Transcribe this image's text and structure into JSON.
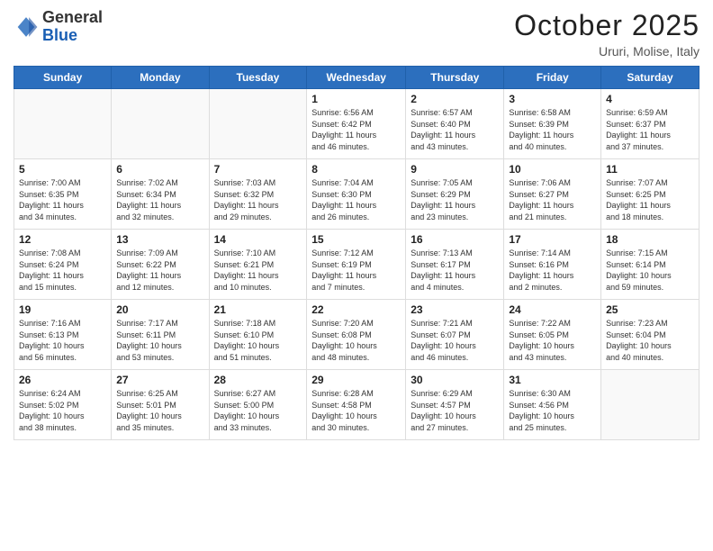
{
  "header": {
    "logo_general": "General",
    "logo_blue": "Blue",
    "month": "October 2025",
    "location": "Ururi, Molise, Italy"
  },
  "weekdays": [
    "Sunday",
    "Monday",
    "Tuesday",
    "Wednesday",
    "Thursday",
    "Friday",
    "Saturday"
  ],
  "weeks": [
    [
      {
        "day": "",
        "info": ""
      },
      {
        "day": "",
        "info": ""
      },
      {
        "day": "",
        "info": ""
      },
      {
        "day": "1",
        "info": "Sunrise: 6:56 AM\nSunset: 6:42 PM\nDaylight: 11 hours\nand 46 minutes."
      },
      {
        "day": "2",
        "info": "Sunrise: 6:57 AM\nSunset: 6:40 PM\nDaylight: 11 hours\nand 43 minutes."
      },
      {
        "day": "3",
        "info": "Sunrise: 6:58 AM\nSunset: 6:39 PM\nDaylight: 11 hours\nand 40 minutes."
      },
      {
        "day": "4",
        "info": "Sunrise: 6:59 AM\nSunset: 6:37 PM\nDaylight: 11 hours\nand 37 minutes."
      }
    ],
    [
      {
        "day": "5",
        "info": "Sunrise: 7:00 AM\nSunset: 6:35 PM\nDaylight: 11 hours\nand 34 minutes."
      },
      {
        "day": "6",
        "info": "Sunrise: 7:02 AM\nSunset: 6:34 PM\nDaylight: 11 hours\nand 32 minutes."
      },
      {
        "day": "7",
        "info": "Sunrise: 7:03 AM\nSunset: 6:32 PM\nDaylight: 11 hours\nand 29 minutes."
      },
      {
        "day": "8",
        "info": "Sunrise: 7:04 AM\nSunset: 6:30 PM\nDaylight: 11 hours\nand 26 minutes."
      },
      {
        "day": "9",
        "info": "Sunrise: 7:05 AM\nSunset: 6:29 PM\nDaylight: 11 hours\nand 23 minutes."
      },
      {
        "day": "10",
        "info": "Sunrise: 7:06 AM\nSunset: 6:27 PM\nDaylight: 11 hours\nand 21 minutes."
      },
      {
        "day": "11",
        "info": "Sunrise: 7:07 AM\nSunset: 6:25 PM\nDaylight: 11 hours\nand 18 minutes."
      }
    ],
    [
      {
        "day": "12",
        "info": "Sunrise: 7:08 AM\nSunset: 6:24 PM\nDaylight: 11 hours\nand 15 minutes."
      },
      {
        "day": "13",
        "info": "Sunrise: 7:09 AM\nSunset: 6:22 PM\nDaylight: 11 hours\nand 12 minutes."
      },
      {
        "day": "14",
        "info": "Sunrise: 7:10 AM\nSunset: 6:21 PM\nDaylight: 11 hours\nand 10 minutes."
      },
      {
        "day": "15",
        "info": "Sunrise: 7:12 AM\nSunset: 6:19 PM\nDaylight: 11 hours\nand 7 minutes."
      },
      {
        "day": "16",
        "info": "Sunrise: 7:13 AM\nSunset: 6:17 PM\nDaylight: 11 hours\nand 4 minutes."
      },
      {
        "day": "17",
        "info": "Sunrise: 7:14 AM\nSunset: 6:16 PM\nDaylight: 11 hours\nand 2 minutes."
      },
      {
        "day": "18",
        "info": "Sunrise: 7:15 AM\nSunset: 6:14 PM\nDaylight: 10 hours\nand 59 minutes."
      }
    ],
    [
      {
        "day": "19",
        "info": "Sunrise: 7:16 AM\nSunset: 6:13 PM\nDaylight: 10 hours\nand 56 minutes."
      },
      {
        "day": "20",
        "info": "Sunrise: 7:17 AM\nSunset: 6:11 PM\nDaylight: 10 hours\nand 53 minutes."
      },
      {
        "day": "21",
        "info": "Sunrise: 7:18 AM\nSunset: 6:10 PM\nDaylight: 10 hours\nand 51 minutes."
      },
      {
        "day": "22",
        "info": "Sunrise: 7:20 AM\nSunset: 6:08 PM\nDaylight: 10 hours\nand 48 minutes."
      },
      {
        "day": "23",
        "info": "Sunrise: 7:21 AM\nSunset: 6:07 PM\nDaylight: 10 hours\nand 46 minutes."
      },
      {
        "day": "24",
        "info": "Sunrise: 7:22 AM\nSunset: 6:05 PM\nDaylight: 10 hours\nand 43 minutes."
      },
      {
        "day": "25",
        "info": "Sunrise: 7:23 AM\nSunset: 6:04 PM\nDaylight: 10 hours\nand 40 minutes."
      }
    ],
    [
      {
        "day": "26",
        "info": "Sunrise: 6:24 AM\nSunset: 5:02 PM\nDaylight: 10 hours\nand 38 minutes."
      },
      {
        "day": "27",
        "info": "Sunrise: 6:25 AM\nSunset: 5:01 PM\nDaylight: 10 hours\nand 35 minutes."
      },
      {
        "day": "28",
        "info": "Sunrise: 6:27 AM\nSunset: 5:00 PM\nDaylight: 10 hours\nand 33 minutes."
      },
      {
        "day": "29",
        "info": "Sunrise: 6:28 AM\nSunset: 4:58 PM\nDaylight: 10 hours\nand 30 minutes."
      },
      {
        "day": "30",
        "info": "Sunrise: 6:29 AM\nSunset: 4:57 PM\nDaylight: 10 hours\nand 27 minutes."
      },
      {
        "day": "31",
        "info": "Sunrise: 6:30 AM\nSunset: 4:56 PM\nDaylight: 10 hours\nand 25 minutes."
      },
      {
        "day": "",
        "info": ""
      }
    ]
  ]
}
